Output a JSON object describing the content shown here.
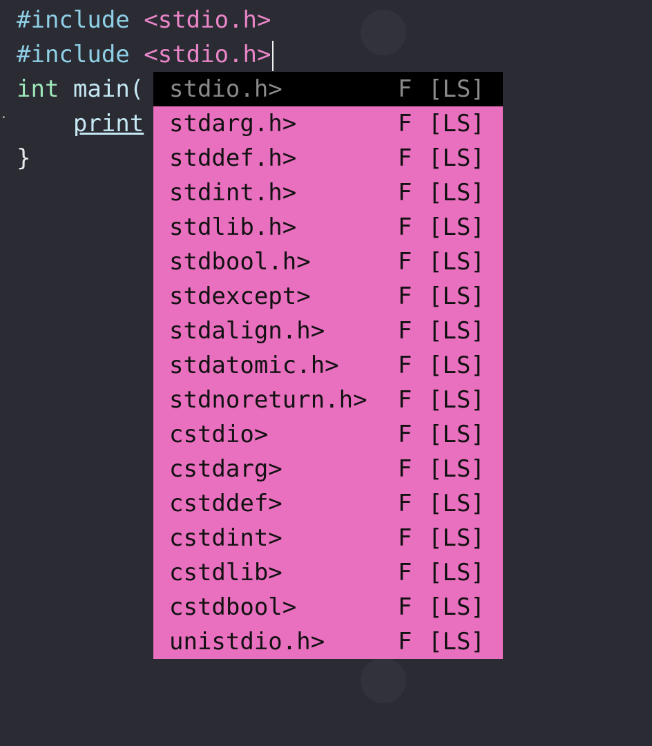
{
  "editor": {
    "lines": [
      {
        "kw": "#include",
        "rest": " ",
        "str": "<stdio.h>"
      },
      {
        "kw": "#include",
        "rest": " ",
        "str": "<stdio.h>"
      },
      {
        "type": "int",
        "rest": " ",
        "fn": "main("
      },
      {
        "indent": "    ",
        "call": "print"
      },
      {
        "text": "}"
      }
    ]
  },
  "completion": {
    "items": [
      {
        "word": "stdio.h>",
        "kind": "F",
        "menu": "[LS]",
        "selected": true
      },
      {
        "word": "stdarg.h>",
        "kind": "F",
        "menu": "[LS]"
      },
      {
        "word": "stddef.h>",
        "kind": "F",
        "menu": "[LS]"
      },
      {
        "word": "stdint.h>",
        "kind": "F",
        "menu": "[LS]"
      },
      {
        "word": "stdlib.h>",
        "kind": "F",
        "menu": "[LS]"
      },
      {
        "word": "stdbool.h>",
        "kind": "F",
        "menu": "[LS]"
      },
      {
        "word": "stdexcept>",
        "kind": "F",
        "menu": "[LS]"
      },
      {
        "word": "stdalign.h>",
        "kind": "F",
        "menu": "[LS]"
      },
      {
        "word": "stdatomic.h>",
        "kind": "F",
        "menu": "[LS]"
      },
      {
        "word": "stdnoreturn.h>",
        "kind": "F",
        "menu": "[LS]"
      },
      {
        "word": "cstdio>",
        "kind": "F",
        "menu": "[LS]"
      },
      {
        "word": "cstdarg>",
        "kind": "F",
        "menu": "[LS]"
      },
      {
        "word": "cstddef>",
        "kind": "F",
        "menu": "[LS]"
      },
      {
        "word": "cstdint>",
        "kind": "F",
        "menu": "[LS]"
      },
      {
        "word": "cstdlib>",
        "kind": "F",
        "menu": "[LS]"
      },
      {
        "word": "cstdbool>",
        "kind": "F",
        "menu": "[LS]"
      },
      {
        "word": "unistdio.h>",
        "kind": "F",
        "menu": "[LS]"
      }
    ]
  },
  "colors": {
    "background": "#2a2b33",
    "popup": "#e96fbf",
    "selected": "#000000",
    "include": "#8fd0e6",
    "string": "#ea86c8",
    "type": "#9fe7b9"
  }
}
